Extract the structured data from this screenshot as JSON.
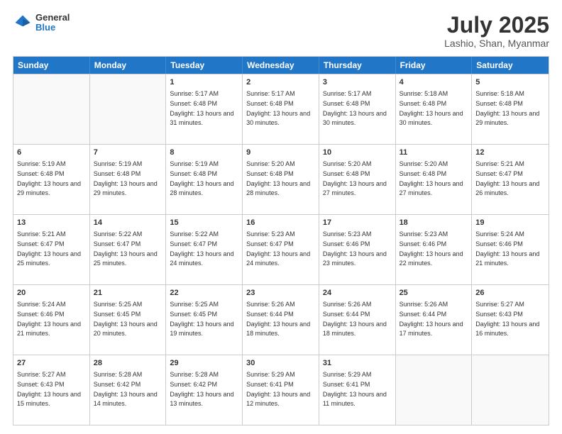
{
  "header": {
    "logo": {
      "general": "General",
      "blue": "Blue"
    },
    "title": "July 2025",
    "subtitle": "Lashio, Shan, Myanmar"
  },
  "days": [
    "Sunday",
    "Monday",
    "Tuesday",
    "Wednesday",
    "Thursday",
    "Friday",
    "Saturday"
  ],
  "weeks": [
    [
      {
        "day": "",
        "info": ""
      },
      {
        "day": "",
        "info": ""
      },
      {
        "day": "1",
        "info": "Sunrise: 5:17 AM\nSunset: 6:48 PM\nDaylight: 13 hours and 31 minutes."
      },
      {
        "day": "2",
        "info": "Sunrise: 5:17 AM\nSunset: 6:48 PM\nDaylight: 13 hours and 30 minutes."
      },
      {
        "day": "3",
        "info": "Sunrise: 5:17 AM\nSunset: 6:48 PM\nDaylight: 13 hours and 30 minutes."
      },
      {
        "day": "4",
        "info": "Sunrise: 5:18 AM\nSunset: 6:48 PM\nDaylight: 13 hours and 30 minutes."
      },
      {
        "day": "5",
        "info": "Sunrise: 5:18 AM\nSunset: 6:48 PM\nDaylight: 13 hours and 29 minutes."
      }
    ],
    [
      {
        "day": "6",
        "info": "Sunrise: 5:19 AM\nSunset: 6:48 PM\nDaylight: 13 hours and 29 minutes."
      },
      {
        "day": "7",
        "info": "Sunrise: 5:19 AM\nSunset: 6:48 PM\nDaylight: 13 hours and 29 minutes."
      },
      {
        "day": "8",
        "info": "Sunrise: 5:19 AM\nSunset: 6:48 PM\nDaylight: 13 hours and 28 minutes."
      },
      {
        "day": "9",
        "info": "Sunrise: 5:20 AM\nSunset: 6:48 PM\nDaylight: 13 hours and 28 minutes."
      },
      {
        "day": "10",
        "info": "Sunrise: 5:20 AM\nSunset: 6:48 PM\nDaylight: 13 hours and 27 minutes."
      },
      {
        "day": "11",
        "info": "Sunrise: 5:20 AM\nSunset: 6:48 PM\nDaylight: 13 hours and 27 minutes."
      },
      {
        "day": "12",
        "info": "Sunrise: 5:21 AM\nSunset: 6:47 PM\nDaylight: 13 hours and 26 minutes."
      }
    ],
    [
      {
        "day": "13",
        "info": "Sunrise: 5:21 AM\nSunset: 6:47 PM\nDaylight: 13 hours and 25 minutes."
      },
      {
        "day": "14",
        "info": "Sunrise: 5:22 AM\nSunset: 6:47 PM\nDaylight: 13 hours and 25 minutes."
      },
      {
        "day": "15",
        "info": "Sunrise: 5:22 AM\nSunset: 6:47 PM\nDaylight: 13 hours and 24 minutes."
      },
      {
        "day": "16",
        "info": "Sunrise: 5:23 AM\nSunset: 6:47 PM\nDaylight: 13 hours and 24 minutes."
      },
      {
        "day": "17",
        "info": "Sunrise: 5:23 AM\nSunset: 6:46 PM\nDaylight: 13 hours and 23 minutes."
      },
      {
        "day": "18",
        "info": "Sunrise: 5:23 AM\nSunset: 6:46 PM\nDaylight: 13 hours and 22 minutes."
      },
      {
        "day": "19",
        "info": "Sunrise: 5:24 AM\nSunset: 6:46 PM\nDaylight: 13 hours and 21 minutes."
      }
    ],
    [
      {
        "day": "20",
        "info": "Sunrise: 5:24 AM\nSunset: 6:46 PM\nDaylight: 13 hours and 21 minutes."
      },
      {
        "day": "21",
        "info": "Sunrise: 5:25 AM\nSunset: 6:45 PM\nDaylight: 13 hours and 20 minutes."
      },
      {
        "day": "22",
        "info": "Sunrise: 5:25 AM\nSunset: 6:45 PM\nDaylight: 13 hours and 19 minutes."
      },
      {
        "day": "23",
        "info": "Sunrise: 5:26 AM\nSunset: 6:44 PM\nDaylight: 13 hours and 18 minutes."
      },
      {
        "day": "24",
        "info": "Sunrise: 5:26 AM\nSunset: 6:44 PM\nDaylight: 13 hours and 18 minutes."
      },
      {
        "day": "25",
        "info": "Sunrise: 5:26 AM\nSunset: 6:44 PM\nDaylight: 13 hours and 17 minutes."
      },
      {
        "day": "26",
        "info": "Sunrise: 5:27 AM\nSunset: 6:43 PM\nDaylight: 13 hours and 16 minutes."
      }
    ],
    [
      {
        "day": "27",
        "info": "Sunrise: 5:27 AM\nSunset: 6:43 PM\nDaylight: 13 hours and 15 minutes."
      },
      {
        "day": "28",
        "info": "Sunrise: 5:28 AM\nSunset: 6:42 PM\nDaylight: 13 hours and 14 minutes."
      },
      {
        "day": "29",
        "info": "Sunrise: 5:28 AM\nSunset: 6:42 PM\nDaylight: 13 hours and 13 minutes."
      },
      {
        "day": "30",
        "info": "Sunrise: 5:29 AM\nSunset: 6:41 PM\nDaylight: 13 hours and 12 minutes."
      },
      {
        "day": "31",
        "info": "Sunrise: 5:29 AM\nSunset: 6:41 PM\nDaylight: 13 hours and 11 minutes."
      },
      {
        "day": "",
        "info": ""
      },
      {
        "day": "",
        "info": ""
      }
    ]
  ]
}
